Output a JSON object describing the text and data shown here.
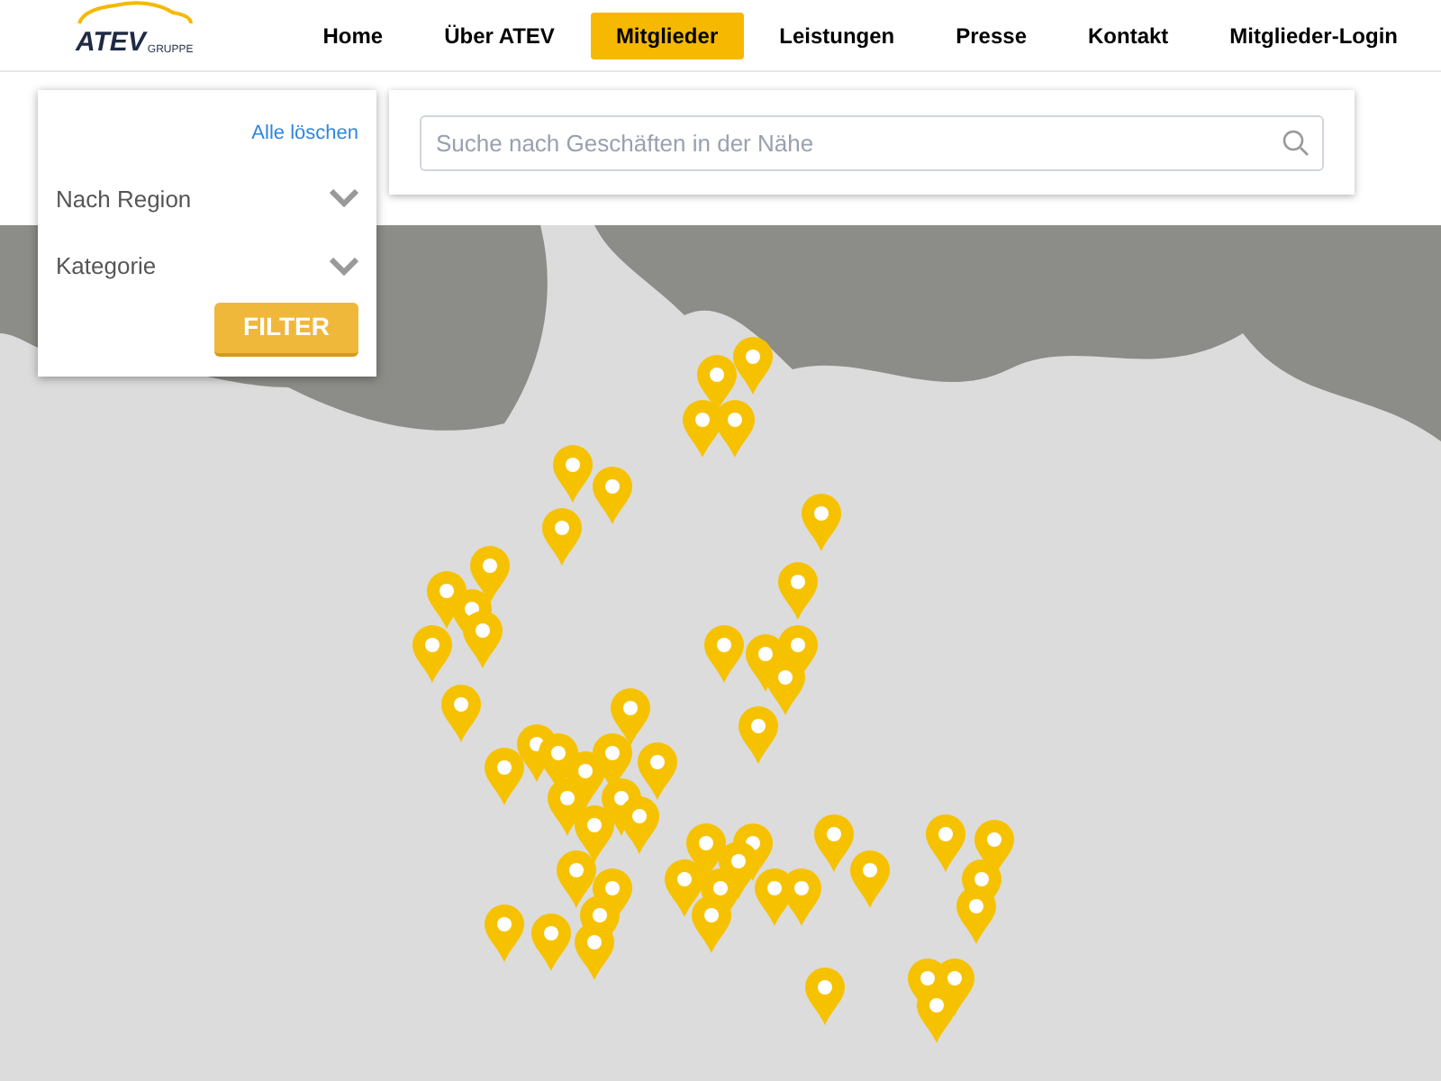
{
  "logo": {
    "name": "ATEV",
    "suffix": "GRUPPE"
  },
  "nav": [
    {
      "label": "Home",
      "selected": false
    },
    {
      "label": "Über ATEV",
      "selected": false
    },
    {
      "label": "Mitglieder",
      "selected": true
    },
    {
      "label": "Leistungen",
      "selected": false
    },
    {
      "label": "Presse",
      "selected": false
    },
    {
      "label": "Kontakt",
      "selected": false
    },
    {
      "label": "Mitglieder-Login",
      "selected": false
    }
  ],
  "filter": {
    "clear_link": "Alle löschen",
    "dropdowns": [
      "Nach Region",
      "Kategorie"
    ],
    "button": "FILTER"
  },
  "search": {
    "placeholder": "Suche nach Geschäften in der Nähe"
  }
}
